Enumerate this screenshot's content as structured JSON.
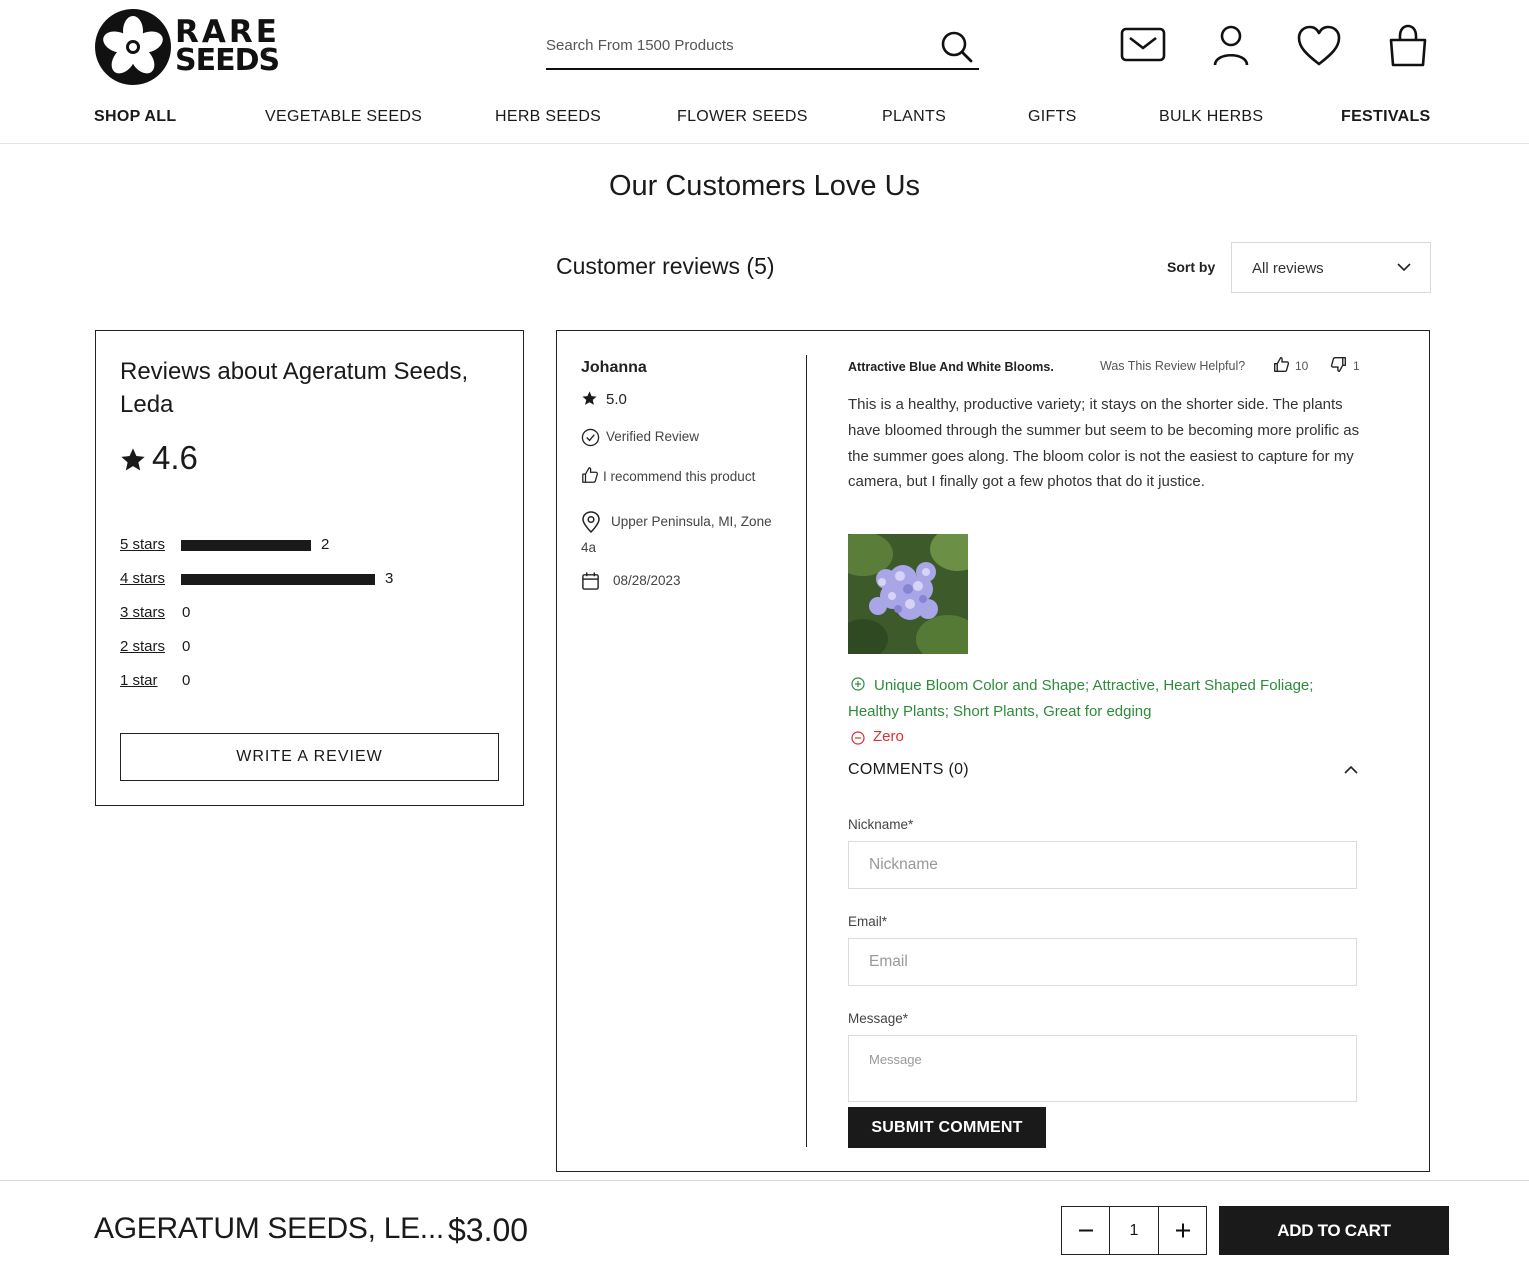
{
  "brand": {
    "line1": "RARE",
    "line2": "SEEDS",
    "mark": "®"
  },
  "search": {
    "placeholder": "Search From 1500 Products"
  },
  "header_icons": [
    "mail-icon",
    "user-icon",
    "heart-icon",
    "bag-icon"
  ],
  "nav": [
    {
      "label": "SHOP ALL",
      "bold": true
    },
    {
      "label": "VEGETABLE SEEDS",
      "bold": false
    },
    {
      "label": "HERB SEEDS",
      "bold": false
    },
    {
      "label": "FLOWER SEEDS",
      "bold": false
    },
    {
      "label": "PLANTS",
      "bold": false
    },
    {
      "label": "GIFTS",
      "bold": false
    },
    {
      "label": "BULK HERBS",
      "bold": false
    },
    {
      "label": "FESTIVALS",
      "bold": true
    }
  ],
  "section_title": "Our Customers Love Us",
  "reviews_heading": "Customer reviews (5)",
  "sort": {
    "label": "Sort by",
    "value": "All reviews"
  },
  "summary": {
    "title": "Reviews about Ageratum Seeds, Leda",
    "average": "4.6",
    "distribution": [
      {
        "label": "5 stars",
        "count": "2",
        "fraction": 0.67
      },
      {
        "label": "4 stars",
        "count": "3",
        "fraction": 1.0
      },
      {
        "label": "3 stars",
        "count": "0",
        "fraction": 0
      },
      {
        "label": "2 stars",
        "count": "0",
        "fraction": 0
      },
      {
        "label": "1 star",
        "count": "0",
        "fraction": 0
      }
    ],
    "write_review": "WRITE A REVIEW"
  },
  "review": {
    "author": "Johanna",
    "rating": "5.0",
    "verified": "Verified Review",
    "recommend": "I recommend this product",
    "location": "Upper Peninsula, MI, Zone 4a",
    "date": "08/28/2023",
    "title": "Attractive Blue And White Blooms.",
    "helpful_label": "Was This Review Helpful?",
    "helpful_up": "10",
    "helpful_down": "1",
    "body": "This is a healthy, productive variety; it stays on the shorter side. The plants have bloomed through the summer but seem to be becoming more prolific as the summer goes along. The bloom color is not the easiest to capture for my camera, but I finally got a few photos that do it justice.",
    "pros": "Unique Bloom Color and Shape; Attractive, Heart Shaped Foliage; Healthy Plants; Short Plants, Great for edging",
    "cons": "Zero",
    "comments_label": "COMMENTS (0)",
    "form": {
      "nickname_label": "Nickname*",
      "nickname_placeholder": "Nickname",
      "email_label": "Email*",
      "email_placeholder": "Email",
      "message_label": "Message*",
      "message_placeholder": "Message",
      "submit": "SUBMIT COMMENT"
    }
  },
  "sticky": {
    "product_name": "AGERATUM SEEDS, LE...",
    "price": "$3.00",
    "quantity": "1",
    "add_to_cart": "ADD TO CART"
  },
  "colors": {
    "pros": "#2e8b3a",
    "cons": "#d93030",
    "ink": "#1a1a1a"
  }
}
